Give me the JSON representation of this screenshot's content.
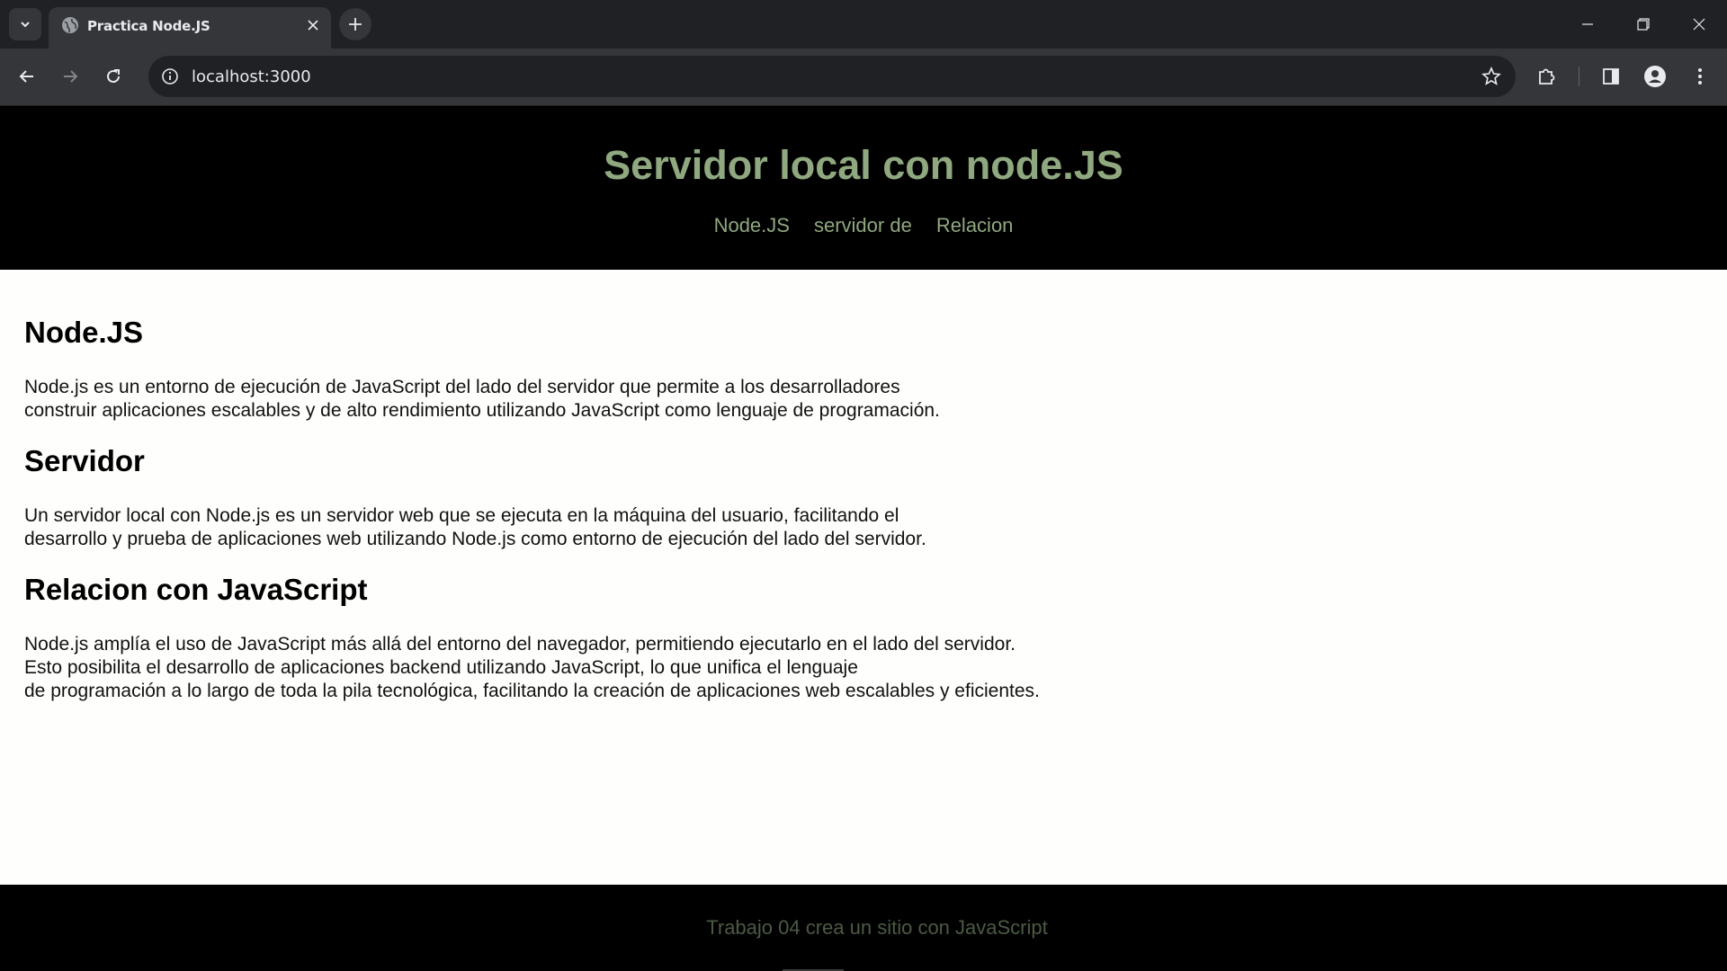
{
  "browser": {
    "tab_title": "Practica Node.JS",
    "url": "localhost:3000"
  },
  "header": {
    "title": "Servidor local con node.JS",
    "nav": [
      "Node.JS",
      "servidor de",
      "Relacion"
    ]
  },
  "sections": [
    {
      "heading": "Node.JS",
      "text": "Node.js es un entorno de ejecución de JavaScript del lado del servidor que permite a los desarrolladores\nconstruir aplicaciones escalables y de alto rendimiento utilizando JavaScript como lenguaje de programación."
    },
    {
      "heading": "Servidor",
      "text": "Un servidor local con Node.js es un servidor web que se ejecuta en la máquina del usuario, facilitando el\ndesarrollo y prueba de aplicaciones web utilizando Node.js como entorno de ejecución del lado del servidor."
    },
    {
      "heading": "Relacion con JavaScript",
      "text": "Node.js amplía el uso de JavaScript más allá del entorno del navegador, permitiendo ejecutarlo en el lado del servidor.\nEsto posibilita el desarrollo de aplicaciones backend utilizando JavaScript, lo que unifica el lenguaje\nde programación a lo largo de toda la pila tecnológica, facilitando la creación de aplicaciones web escalables y eficientes."
    }
  ],
  "footer": {
    "text": "Trabajo 04 crea un sitio con JavaScript"
  },
  "colors": {
    "accent": "#8fa87f",
    "header_bg": "#000000",
    "footer_text": "#4b5a44"
  },
  "icons": [
    "tab-search-icon",
    "globe-icon",
    "close-icon",
    "plus-icon",
    "minimize-icon",
    "restore-icon",
    "window-close-icon",
    "back-arrow-icon",
    "forward-arrow-icon",
    "reload-icon",
    "info-icon",
    "star-icon",
    "extensions-icon",
    "side-panel-icon",
    "profile-icon",
    "menu-dots-icon"
  ]
}
